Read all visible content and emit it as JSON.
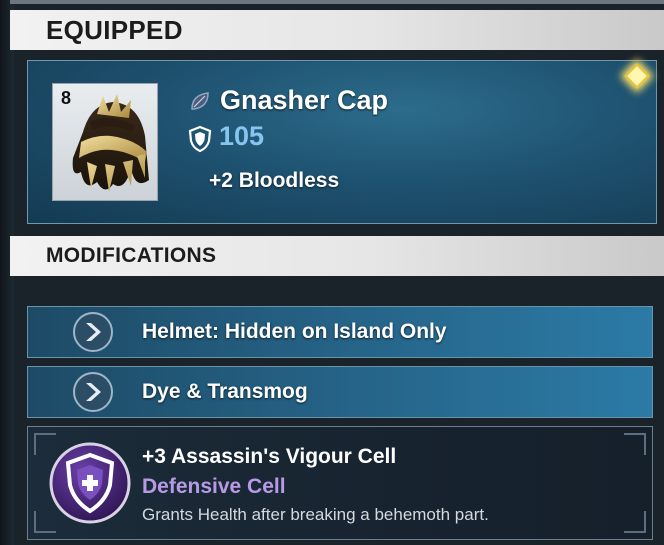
{
  "equipped": {
    "header": "EQUIPPED",
    "item": {
      "tier": "8",
      "name": "Gnasher Cap",
      "armor": "105",
      "perk": "+2 Bloodless",
      "element_icon": "element-leaf-icon",
      "armor_icon": "shield-icon"
    }
  },
  "modifications": {
    "header": "MODIFICATIONS",
    "rows": [
      {
        "label": "Helmet: Hidden on Island Only",
        "icon": "chevron-right-icon"
      },
      {
        "label": "Dye & Transmog",
        "icon": "chevron-right-icon"
      }
    ],
    "cell": {
      "name": "+3 Assassin's Vigour Cell",
      "type": "Defensive Cell",
      "description": "Grants Health after breaking a behemoth part.",
      "icon": "defensive-cell-icon"
    }
  },
  "colors": {
    "accent_blue": "#86c5f0",
    "cell_purple": "#b79ae6",
    "card_blue": "#1e5270"
  }
}
